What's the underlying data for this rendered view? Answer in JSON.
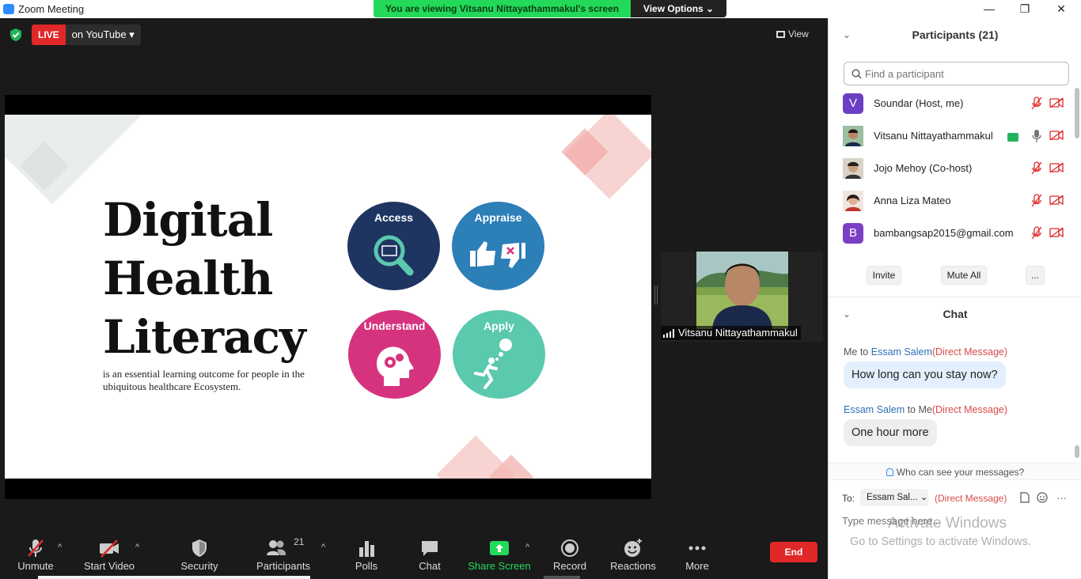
{
  "window": {
    "title": "Zoom Meeting",
    "minimize": "—",
    "maximize": "❐",
    "close": "✕"
  },
  "banner": {
    "message": "You are viewing Vitsanu Nittayathammakul's screen",
    "options": "View Options ⌄"
  },
  "top": {
    "live_badge": "LIVE",
    "live_dest": "on YouTube ▾",
    "view_label": "View"
  },
  "slide": {
    "title_lines": [
      "Digital",
      "Health",
      "Literacy"
    ],
    "subtitle": "is an essential learning outcome for people in the ubiquitous healthcare Ecosystem.",
    "circles": [
      {
        "label": "Access",
        "color": "#1f3561"
      },
      {
        "label": "Appraise",
        "color": "#2d7fb8"
      },
      {
        "label": "Understand",
        "color": "#d6337f"
      },
      {
        "label": "Apply",
        "color": "#5bc9ae"
      }
    ]
  },
  "video": {
    "name": "Vitsanu Nittayathammakul"
  },
  "toolbar": {
    "unmute": "Unmute",
    "start_video": "Start Video",
    "security": "Security",
    "participants": "Participants",
    "participants_count": "21",
    "polls": "Polls",
    "chat": "Chat",
    "share_screen": "Share Screen",
    "record": "Record",
    "reactions": "Reactions",
    "more": "More",
    "end": "End",
    "caret": "^"
  },
  "participants_panel": {
    "title": "Participants (21)",
    "search_placeholder": "Find a participant",
    "list": [
      {
        "name": "Soundar (Host, me)",
        "avatar_letter": "V",
        "avatar_color": "#6a3fc4"
      },
      {
        "name": "Vitsanu Nittayathammakul",
        "avatar_letter": "",
        "avatar_color": "#7a5c40"
      },
      {
        "name": "Jojo Mehoy (Co-host)",
        "avatar_letter": "",
        "avatar_color": "#8d7b6a"
      },
      {
        "name": "Anna Liza Mateo",
        "avatar_letter": "",
        "avatar_color": "#b06a5a"
      },
      {
        "name": "bambangsap2015@gmail.com",
        "avatar_letter": "B",
        "avatar_color": "#7b3fc4"
      }
    ],
    "invite": "Invite",
    "mute_all": "Mute All",
    "more": "..."
  },
  "chat_panel": {
    "title": "Chat",
    "messages": [
      {
        "prefix": "Me to ",
        "name": "Essam Salem",
        "suffix": "",
        "dm": "(Direct Message)",
        "text": "How long can you stay now?"
      },
      {
        "prefix": "",
        "name": "Essam Salem",
        "suffix": " to Me",
        "dm": "(Direct Message)",
        "text": "One hour more"
      }
    ],
    "who_can_see": "Who can see your messages?",
    "to_label": "To:",
    "to_value": "Essam Sal... ⌄",
    "to_dm": "(Direct Message)",
    "input_placeholder": "Type message here...",
    "more_label": "···"
  },
  "watermark": {
    "line1": "Activate Windows",
    "line2": "Go to Settings to activate Windows."
  }
}
